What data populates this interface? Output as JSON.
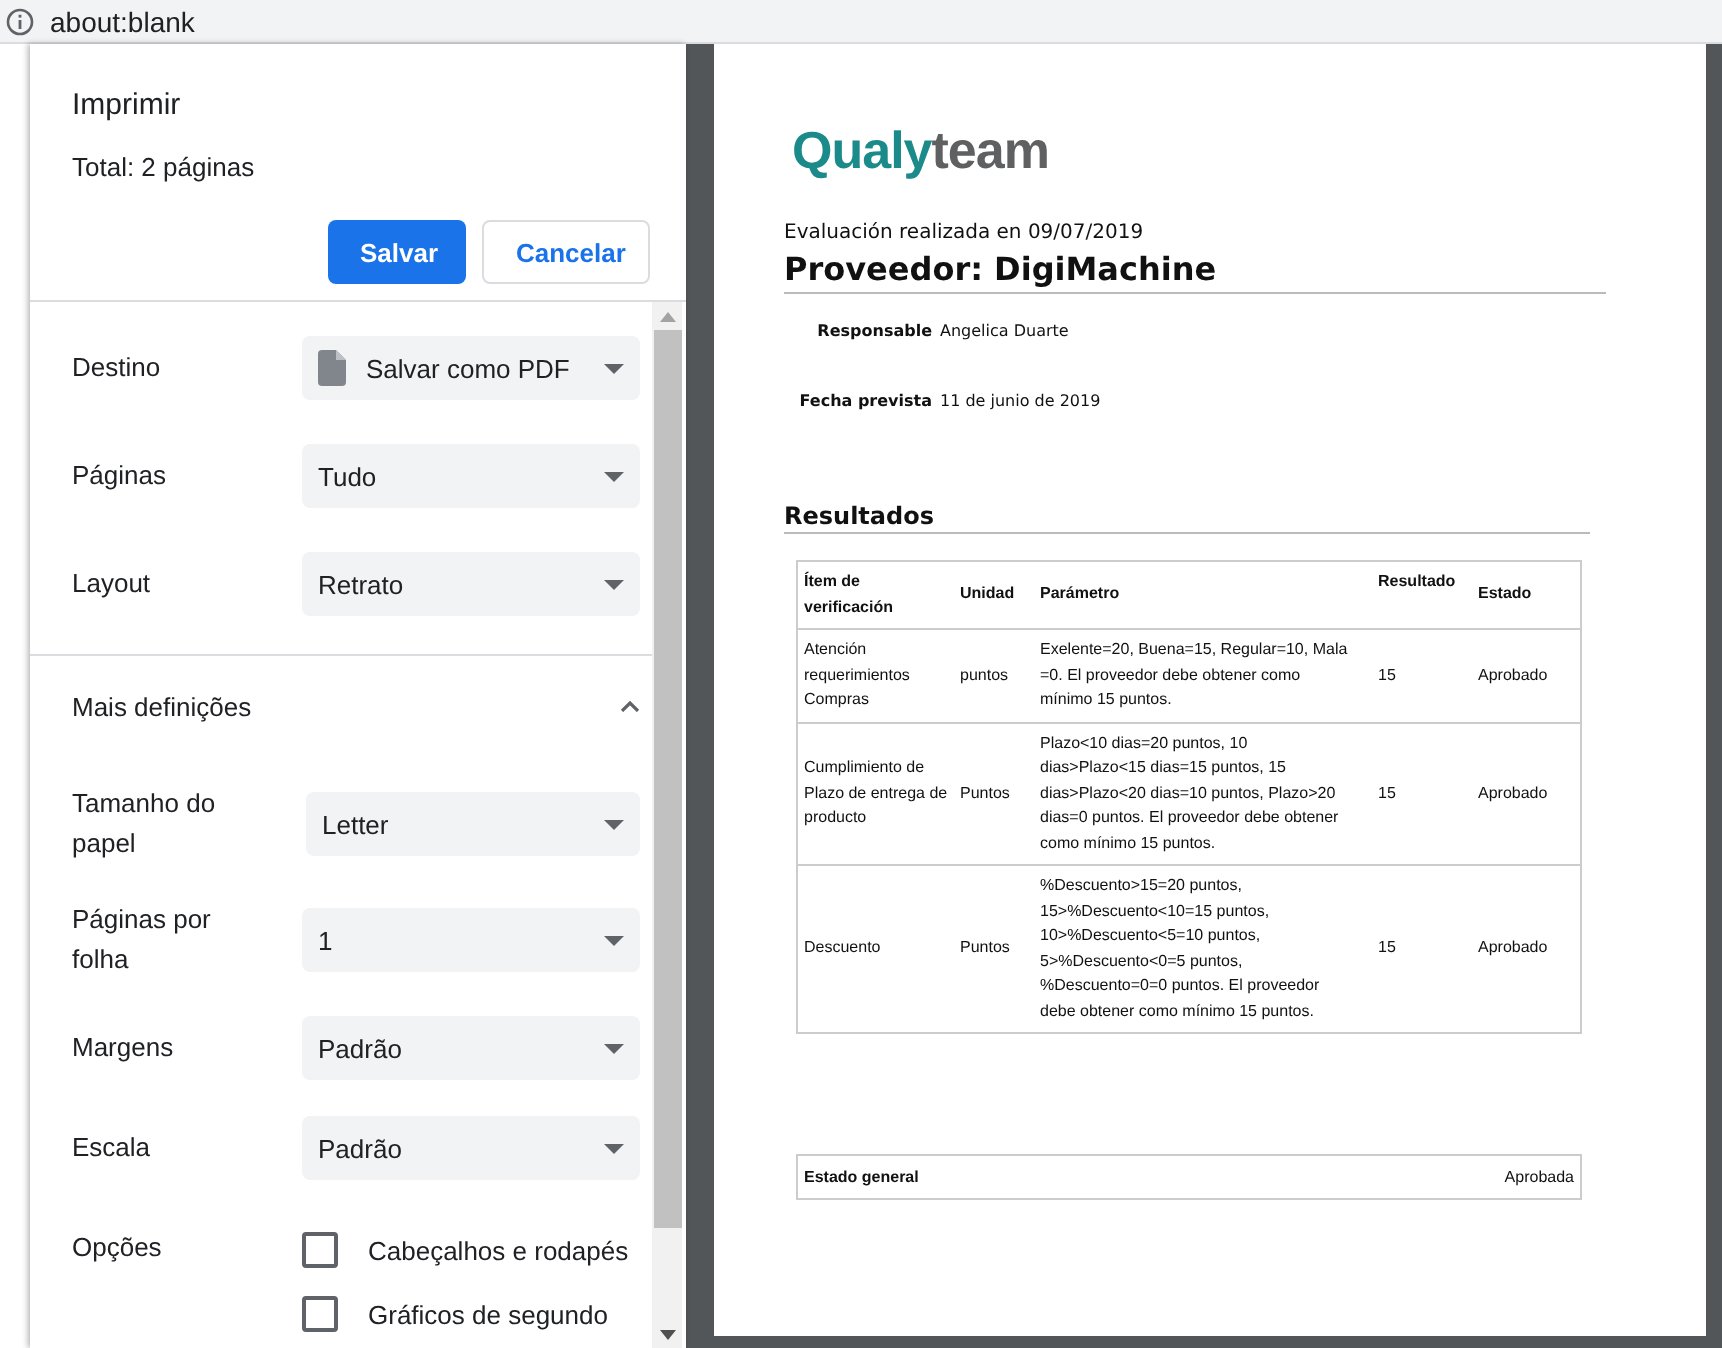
{
  "address_bar": {
    "url": "about:blank"
  },
  "print_dialog": {
    "title": "Imprimir",
    "total": "Total: 2 páginas",
    "buttons": [
      {
        "label": "Salvar",
        "kind": "primary"
      },
      {
        "label": "Cancelar",
        "kind": "secondary"
      }
    ],
    "settings": [
      {
        "label": "Destino",
        "value": "Salvar como PDF",
        "kind": "destination"
      },
      {
        "label": "Páginas",
        "value": "Tudo",
        "kind": "select"
      },
      {
        "label": "Layout",
        "value": "Retrato",
        "kind": "select"
      }
    ],
    "more_settings": {
      "label": "Mais definições",
      "expanded": true
    },
    "advanced_settings": [
      {
        "label": "Tamanho do papel",
        "value": "Letter",
        "kind": "select"
      },
      {
        "label": "Páginas por folha",
        "value": "1",
        "kind": "select"
      },
      {
        "label": "Margens",
        "value": "Padrão",
        "kind": "select"
      },
      {
        "label": "Escala",
        "value": "Padrão",
        "kind": "select"
      },
      {
        "label": "Opções",
        "kind": "checkboxes",
        "options": [
          {
            "label": "Cabeçalhos e rodapés",
            "checked": false
          },
          {
            "label": "Gráficos de segundo",
            "checked": false
          }
        ]
      }
    ]
  },
  "preview": {
    "logo": [
      {
        "text": "Qualy",
        "color": "#1b8a8a"
      },
      {
        "text": "team",
        "color": "#5f6062"
      }
    ],
    "evaluation_date": "Evaluación realizada en 09/07/2019",
    "supplier": "Proveedor: DigiMachine",
    "fields": [
      {
        "label": "Responsable",
        "value": "Angelica Duarte"
      },
      {
        "label": "Fecha prevista",
        "value": "11 de junio de 2019"
      }
    ],
    "results_heading": "Resultados",
    "table": {
      "columns": [
        "Ítem de verificación",
        "Unidad",
        "Parámetro",
        "Resultado",
        "Estado"
      ],
      "rows": [
        [
          "Atención requerimientos Compras",
          "puntos",
          "Exelente=20, Buena=15, Regular=10, Mala =0. El proveedor debe obtener como mínimo 15 puntos.",
          "15",
          "Aprobado"
        ],
        [
          "Cumplimiento de Plazo de entrega de producto",
          "Puntos",
          "Plazo<10 dias=20 puntos, 10 dias>Plazo<15 dias=15 puntos, 15 dias>Plazo<20 dias=10 puntos, Plazo>20 dias=0 puntos. El proveedor debe obtener como mínimo 15 puntos.",
          "15",
          "Aprobado"
        ],
        [
          "Descuento",
          "Puntos",
          "%Descuento>15=20 puntos, 15>%Descuento<10=15 puntos, 10>%Descuento<5=10 puntos, 5>%Descuento<0=5 puntos, %Descuento=0=0 puntos. El proveedor debe obtener como mínimo 15 puntos.",
          "15",
          "Aprobado"
        ]
      ]
    },
    "summary": {
      "label": "Estado general",
      "value": "Aprobada"
    }
  }
}
